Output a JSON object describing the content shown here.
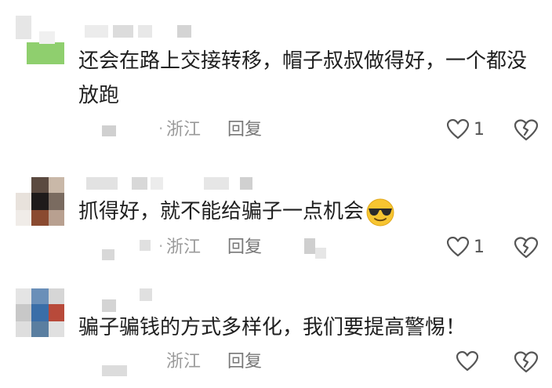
{
  "comments": [
    {
      "text": "还会在路上交接转移，帽子叔叔做得好，一个都没放跑",
      "location": "浙江",
      "reply_label": "回复",
      "like_count": "1",
      "like_icon": "heart-outline-icon",
      "dislike_icon": "broken-heart-icon"
    },
    {
      "text": "抓得好，就不能给骗子一点机会",
      "emoji": "cool-face-with-sunglasses",
      "location": "浙江",
      "reply_label": "回复",
      "like_count": "1",
      "like_icon": "heart-outline-icon",
      "dislike_icon": "broken-heart-icon"
    },
    {
      "text": "骗子骗钱的方式多样化，我们要提高警惕！",
      "location": "浙江",
      "reply_label": "回复",
      "like_count": "",
      "like_icon": "heart-outline-icon",
      "dislike_icon": "broken-heart-icon"
    }
  ],
  "colors": {
    "text": "#1f1f1f",
    "meta": "#9a9a9a",
    "reply": "#777777",
    "icon": "#555555",
    "emoji_face": "#f7c531"
  }
}
